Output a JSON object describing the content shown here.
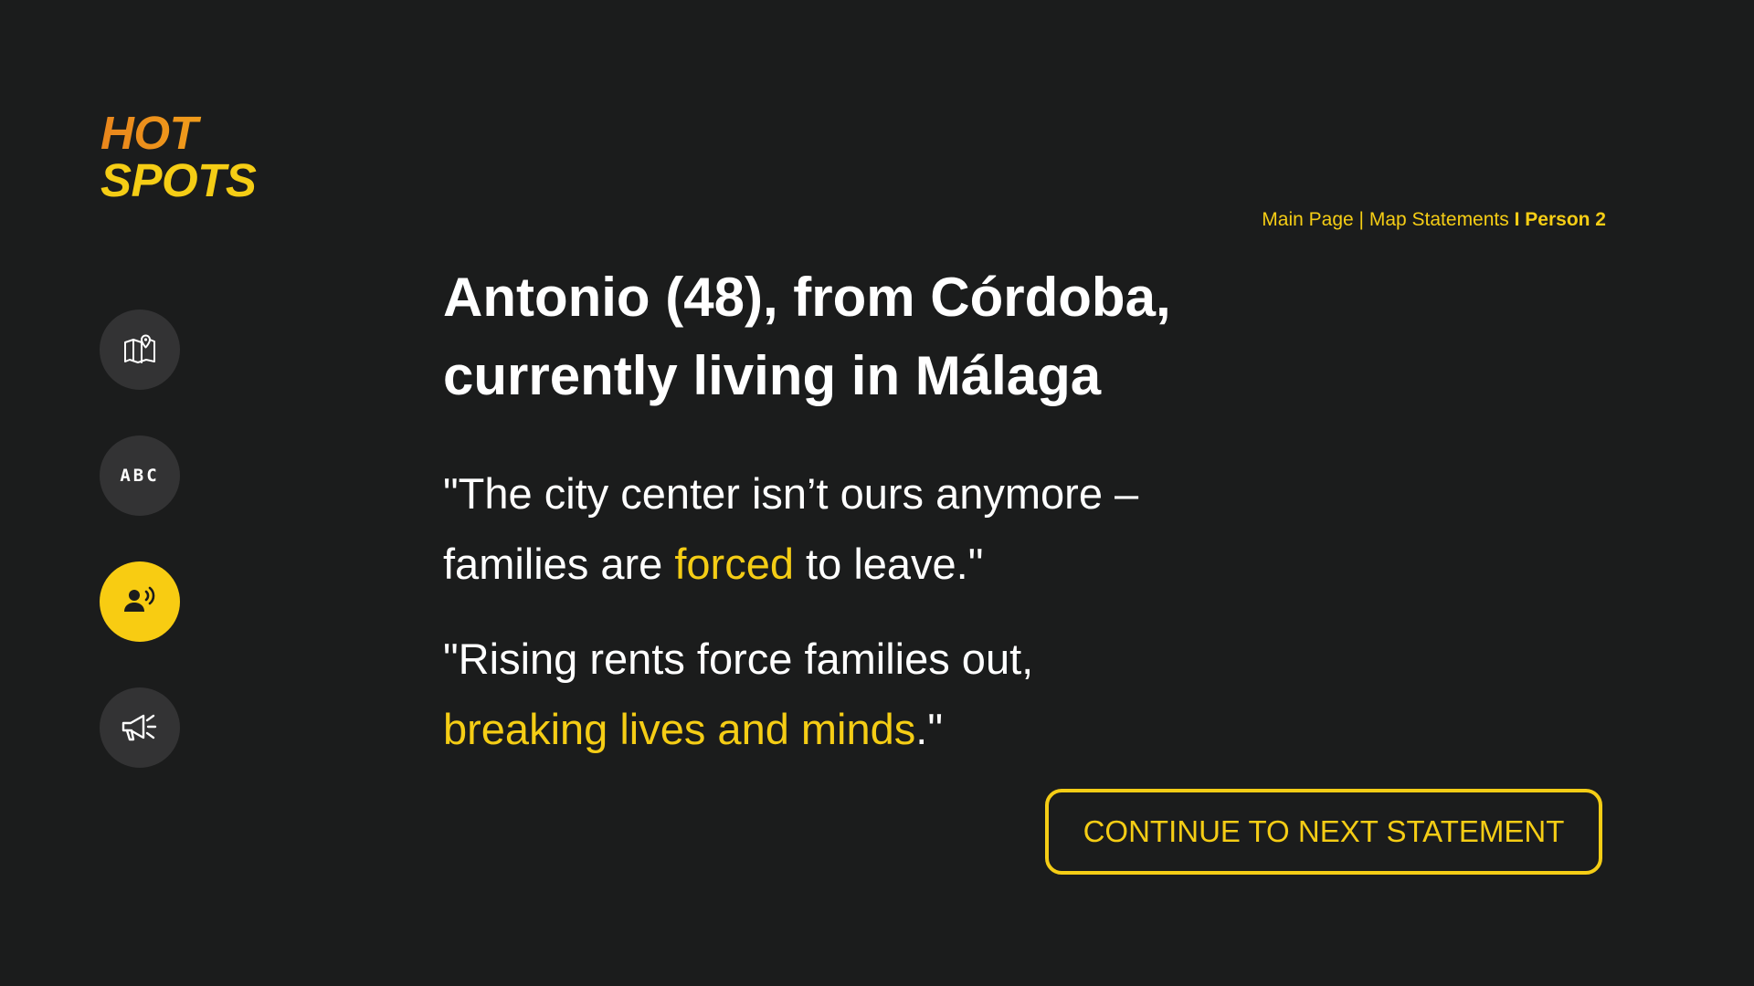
{
  "logo": {
    "line1": "HOT",
    "line2": "SPOTS"
  },
  "breadcrumb": {
    "items": [
      "Main Page",
      "Map Statements"
    ],
    "separator": "|",
    "current_separator": "I",
    "current": "Person 2"
  },
  "nav": {
    "items": [
      {
        "icon": "map-pin-icon",
        "active": false
      },
      {
        "icon": "abc-icon",
        "label": "ABC",
        "active": false
      },
      {
        "icon": "person-speaking-icon",
        "active": true
      },
      {
        "icon": "megaphone-icon",
        "active": false
      }
    ]
  },
  "heading": {
    "line1": "Antonio (48), from Córdoba,",
    "line2": "currently living in Málaga"
  },
  "quotes": [
    {
      "line1": "\"The city center isn’t ours anymore –",
      "line2_pre": "families are ",
      "line2_highlight": "forced",
      "line2_post": " to leave.\""
    },
    {
      "line1": "\"Rising rents force families out,",
      "line2_highlight": "breaking lives and minds",
      "line2_post": ".\""
    }
  ],
  "continue_button": {
    "label": "CONTINUE TO NEXT STATEMENT"
  },
  "colors": {
    "background": "#1b1c1c",
    "accent": "#f5cd15",
    "logo_orange": "#e9861c",
    "nav_button": "#333334",
    "text": "#ffffff"
  }
}
